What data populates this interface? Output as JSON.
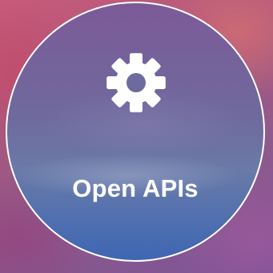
{
  "badge": {
    "label": "Open APIs",
    "icon": "gear-icon"
  },
  "colors": {
    "icon": "#ffffff",
    "text": "#ffffff",
    "ring": "#ffffff"
  }
}
